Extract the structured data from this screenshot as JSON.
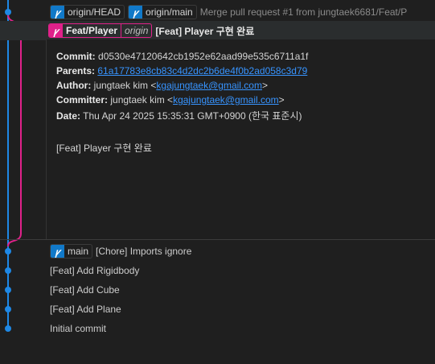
{
  "colors": {
    "blue_lane": "#1e88e5",
    "pink_lane": "#e0218a",
    "background": "#1f1f1f"
  },
  "rows": {
    "merge": {
      "badges": [
        "origin/HEAD",
        "origin/main"
      ],
      "message": "Merge pull request #1 from jungtaek6681/Feat/P"
    },
    "selected": {
      "branch": "Feat/Player",
      "remote": "origin",
      "message": "[Feat] Player 구현 완료"
    },
    "chore": {
      "badge": "main",
      "message": "[Chore] Imports ignore"
    },
    "rigidbody": {
      "message": "[Feat] Add Rigidbody"
    },
    "cube": {
      "message": "[Feat] Add Cube"
    },
    "plane": {
      "message": "[Feat] Add Plane"
    },
    "initial": {
      "message": "Initial commit"
    }
  },
  "details": {
    "commit_label": "Commit:",
    "commit_value": "d0530e47120642cb1952e62aad99e535c6711a1f",
    "parents_label": "Parents:",
    "parents_value": "61a17783e8cb83c4d2dc2b6de4f0b2ad058c3d79",
    "author_label": "Author:",
    "author_name": "jungtaek kim <",
    "author_email": "kgajungtaek@gmail.com",
    "author_close": ">",
    "committer_label": "Committer:",
    "committer_name": "jungtaek kim <",
    "committer_email": "kgajungtaek@gmail.com",
    "committer_close": ">",
    "date_label": "Date:",
    "date_value": "Thu Apr 24 2025 15:35:31 GMT+0900 (한국 표준시)",
    "message": "[Feat] Player 구현 완료"
  },
  "icons": {
    "ref_icon": "git-ref-icon"
  }
}
